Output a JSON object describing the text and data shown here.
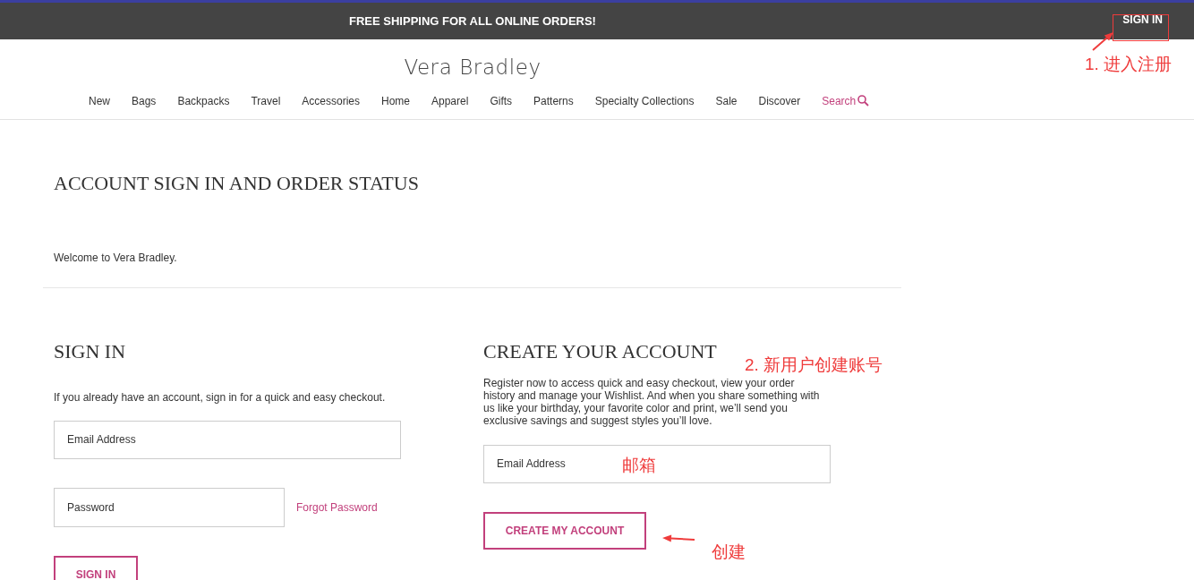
{
  "promo_bar": {
    "message": "FREE SHIPPING FOR ALL ONLINE ORDERS!",
    "sign_in": "SIGN IN"
  },
  "logo": "Vera Bradley",
  "nav": [
    {
      "label": "New",
      "kind": "link"
    },
    {
      "label": "Bags",
      "kind": "link"
    },
    {
      "label": "Backpacks",
      "kind": "link"
    },
    {
      "label": "Travel",
      "kind": "link"
    },
    {
      "label": "Accessories",
      "kind": "link"
    },
    {
      "label": "Home",
      "kind": "link"
    },
    {
      "label": "Apparel",
      "kind": "link"
    },
    {
      "label": "Gifts",
      "kind": "link"
    },
    {
      "label": "Patterns",
      "kind": "link"
    },
    {
      "label": "Specialty Collections",
      "kind": "link"
    },
    {
      "label": "Sale",
      "kind": "link"
    },
    {
      "label": "Discover",
      "kind": "link"
    },
    {
      "label": "Search",
      "kind": "search"
    }
  ],
  "page_title": "ACCOUNT SIGN IN AND ORDER STATUS",
  "welcome": "Welcome to Vera Bradley.",
  "sign_in": {
    "heading": "SIGN IN",
    "intro": "If you already have an account, sign in for a quick and easy checkout.",
    "email_placeholder": "Email Address",
    "password_placeholder": "Password",
    "forgot_link": "Forgot Password",
    "button": "SIGN IN"
  },
  "create_account": {
    "heading": "CREATE YOUR ACCOUNT",
    "intro": "Register now to access quick and easy checkout,  view your order history and manage your Wishlist. And when you share something with us like your birthday, your favorite color and print,  we’ll send you exclusive savings and suggest styles you’ll love.",
    "email_placeholder": "Email Address",
    "button": "CREATE MY ACCOUNT"
  },
  "annotations": [
    {
      "text": "1. 进入注册"
    },
    {
      "text": "2. 新用户创建账号"
    },
    {
      "text": "邮箱"
    },
    {
      "text": "创建"
    }
  ]
}
